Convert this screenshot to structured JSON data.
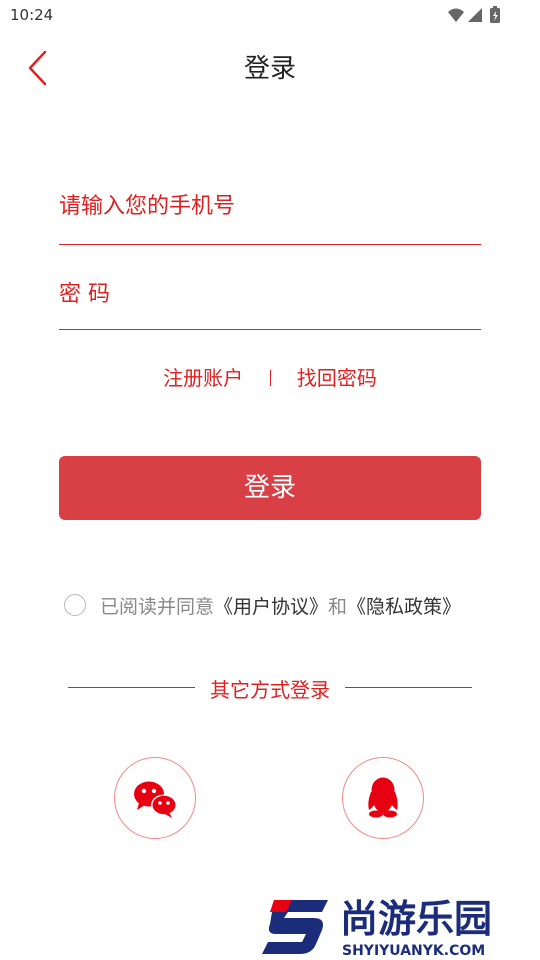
{
  "status_bar": {
    "time": "10:24"
  },
  "nav": {
    "title": "登录",
    "back_icon": "chevron-left-icon"
  },
  "phone_field": {
    "placeholder": "请输入您的手机号",
    "value": ""
  },
  "password_field": {
    "placeholder": "密 码",
    "value": ""
  },
  "links": {
    "register": "注册账户",
    "forgot": "找回密码"
  },
  "login_button": {
    "label": "登录"
  },
  "agreement": {
    "prefix": "已阅读并同意",
    "user_agreement": "《用户协议》",
    "conjunction": "和",
    "privacy_policy": "《隐私政策》",
    "checked": false
  },
  "other_login": {
    "label": "其它方式登录",
    "options": [
      {
        "name": "wechat",
        "icon": "wechat-icon"
      },
      {
        "name": "qq",
        "icon": "qq-icon"
      }
    ]
  },
  "watermark": {
    "brand": "尚游乐园",
    "domain": "SHYIYUANYK.COM"
  },
  "colors": {
    "accent": "#e02020",
    "button": "#d94046",
    "text_muted": "#888888"
  }
}
